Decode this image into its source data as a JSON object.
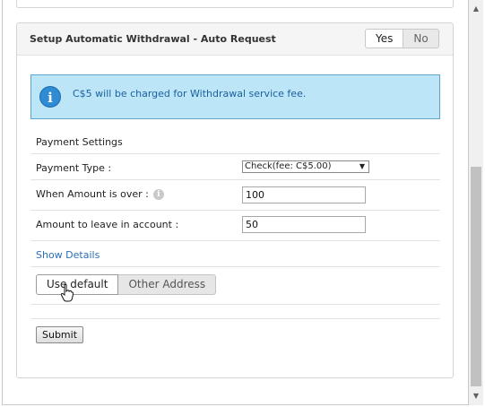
{
  "panel": {
    "title": "Setup Automatic Withdrawal - Auto Request",
    "toggle_yes": "Yes",
    "toggle_no": "No",
    "toggle_selected": "Yes"
  },
  "info": {
    "icon": "info-icon",
    "message": "C$5 will be charged for Withdrawal service fee."
  },
  "form": {
    "section_label": "Payment Settings",
    "payment_type_label": "Payment Type :",
    "payment_type_value": "Check(fee: C$5.00)",
    "amount_over_label": "When Amount is over :",
    "amount_over_value": "100",
    "amount_leave_label": "Amount to leave in account :",
    "amount_leave_value": "50",
    "show_details": "Show Details",
    "use_default": "Use default",
    "other_address": "Other Address",
    "address_selected": "Use default",
    "submit": "Submit"
  },
  "colors": {
    "info_bg": "#bde5f8",
    "info_border": "#5fa3c9",
    "info_text": "#1a5f9e",
    "link": "#2a6fb8"
  }
}
